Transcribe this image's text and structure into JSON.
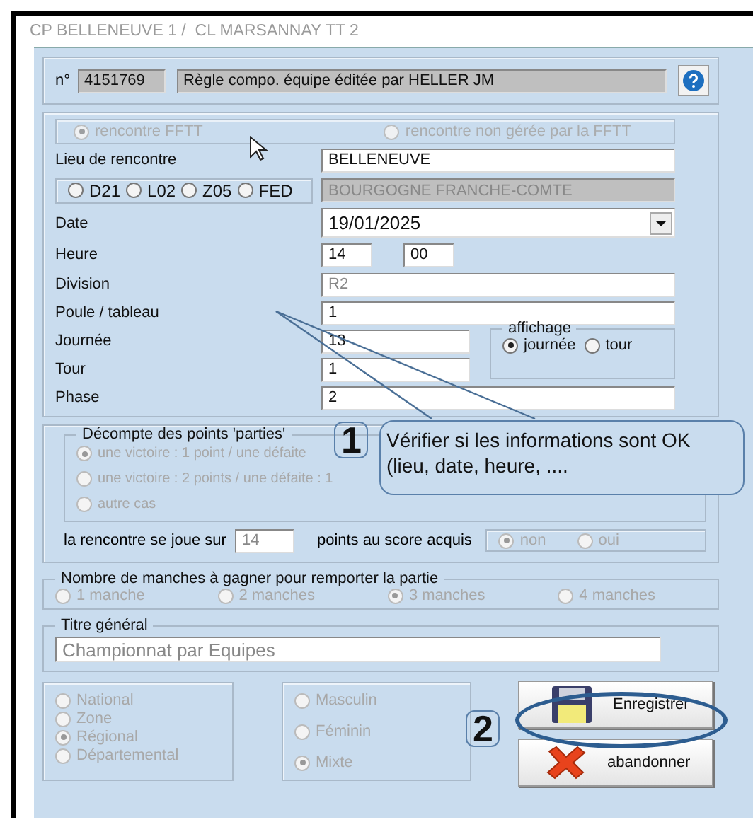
{
  "window": {
    "title": "CP BELLENEUVE 1 /  CL MARSANNAY TT 2"
  },
  "header": {
    "number_label": "n°",
    "number": "4151769",
    "rule": "Règle compo. équipe éditée par HELLER JM"
  },
  "match_type": {
    "disabled": true,
    "options": [
      {
        "label": "rencontre FFTT",
        "selected": true
      },
      {
        "label": "rencontre non gérée par la FFTT",
        "selected": false
      }
    ]
  },
  "lieu": {
    "label": "Lieu de rencontre",
    "value": "BELLENEUVE"
  },
  "level": {
    "options": [
      {
        "label": "D21",
        "selected": false
      },
      {
        "label": "L02",
        "selected": false
      },
      {
        "label": "Z05",
        "selected": false
      },
      {
        "label": "FED",
        "selected": false
      }
    ],
    "value": "BOURGOGNE FRANCHE-COMTE"
  },
  "date": {
    "label": "Date",
    "value": "19/01/2025"
  },
  "heure": {
    "label": "Heure",
    "hours": "14",
    "minutes": "00"
  },
  "division": {
    "label": "Division",
    "value": "R2",
    "disabled": true
  },
  "poule": {
    "label": "Poule / tableau",
    "value": "1"
  },
  "journee": {
    "label": "Journée",
    "value": "13"
  },
  "tour": {
    "label": "Tour",
    "value": "1"
  },
  "phase": {
    "label": "Phase",
    "value": "2"
  },
  "affichage": {
    "title": "affichage",
    "options": [
      {
        "label": "journée",
        "selected": true
      },
      {
        "label": "tour",
        "selected": false
      }
    ]
  },
  "decompte": {
    "title": "Décompte des points 'parties'",
    "disabled": true,
    "options": [
      {
        "label": "une victoire : 1 point / une défaite",
        "selected": true
      },
      {
        "label": "une victoire : 2 points / une défaite : 1",
        "selected": false
      },
      {
        "label": "autre cas",
        "selected": false
      }
    ]
  },
  "score": {
    "label": "la rencontre se joue sur",
    "value": "14",
    "suffix": "points au score acquis",
    "disabled": true,
    "options": [
      {
        "label": "non",
        "selected": true
      },
      {
        "label": "oui",
        "selected": false
      }
    ]
  },
  "manches": {
    "title": "Nombre de manches à gagner pour remporter la partie",
    "disabled": true,
    "options": [
      {
        "label": "1 manche",
        "selected": false
      },
      {
        "label": "2 manches",
        "selected": false
      },
      {
        "label": "3 manches",
        "selected": true
      },
      {
        "label": "4 manches",
        "selected": false
      }
    ]
  },
  "titre": {
    "title": "Titre général",
    "value": "Championnat par Equipes"
  },
  "scope": {
    "disabled": true,
    "options": [
      {
        "label": "National",
        "selected": false
      },
      {
        "label": "Zone",
        "selected": false
      },
      {
        "label": "Régional",
        "selected": true
      },
      {
        "label": "Départemental",
        "selected": false
      }
    ]
  },
  "gender": {
    "disabled": true,
    "options": [
      {
        "label": "Masculin",
        "selected": false
      },
      {
        "label": "Féminin",
        "selected": false
      },
      {
        "label": "Mixte",
        "selected": true
      }
    ]
  },
  "buttons": [
    {
      "kind": "save",
      "label": "Enregistrer",
      "circled": true
    },
    {
      "kind": "cancel",
      "label": "abandonner",
      "circled": false
    }
  ],
  "annotations": [
    {
      "number": "1",
      "text": "Vérifier si les informations sont OK (lieu, date, heure, ...."
    },
    {
      "number": "2"
    }
  ]
}
